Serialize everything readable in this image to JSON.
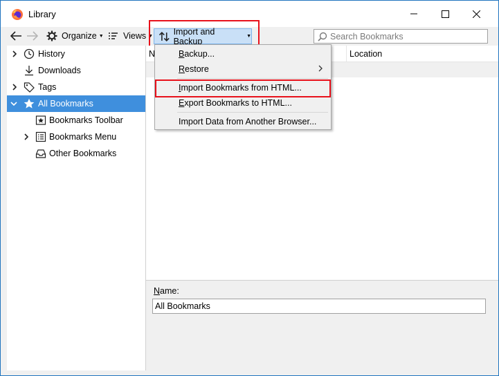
{
  "window": {
    "title": "Library",
    "controls": [
      "minimize",
      "maximize",
      "close"
    ]
  },
  "toolbar": {
    "back_icon": "arrow-left-icon",
    "forward_icon": "arrow-right-icon",
    "organize_label": "Organize",
    "views_label": "Views",
    "import_backup_label": "Import and Backup",
    "search_placeholder": "Search Bookmarks"
  },
  "sidebar": {
    "items": [
      {
        "label": "History",
        "icon": "clock-icon",
        "expandable": true,
        "selected": false
      },
      {
        "label": "Downloads",
        "icon": "download-icon",
        "expandable": false,
        "selected": false
      },
      {
        "label": "Tags",
        "icon": "tag-icon",
        "expandable": true,
        "selected": false
      },
      {
        "label": "All Bookmarks",
        "icon": "star-icon",
        "expandable": true,
        "expanded": true,
        "selected": true
      },
      {
        "label": "Bookmarks Toolbar",
        "icon": "bookmarks-toolbar-icon",
        "expandable": false,
        "selected": false
      },
      {
        "label": "Bookmarks Menu",
        "icon": "bookmarks-menu-icon",
        "expandable": true,
        "selected": false
      },
      {
        "label": "Other Bookmarks",
        "icon": "tray-icon",
        "expandable": false,
        "selected": false
      }
    ]
  },
  "columns": {
    "name_partial": "N",
    "location": "Location"
  },
  "menu": {
    "items": [
      {
        "label": "Backup...",
        "accel": "B",
        "rest": "ackup...",
        "submenu": false
      },
      {
        "label": "Restore",
        "accel": "R",
        "rest": "estore",
        "submenu": true
      },
      {
        "label": "Import Bookmarks from HTML...",
        "accel": "I",
        "rest": "mport Bookmarks from HTML...",
        "submenu": false,
        "highlighted_box": true
      },
      {
        "label": "Export Bookmarks to HTML...",
        "accel": "E",
        "rest": "xport Bookmarks to HTML...",
        "submenu": false
      },
      {
        "label": "Import Data from Another Browser...",
        "accel": "",
        "rest": "Import Data from Another Browser...",
        "submenu": false
      }
    ]
  },
  "details": {
    "name_label": "Name:",
    "name_accel": "N",
    "name_rest": "ame:",
    "name_value": "All Bookmarks"
  },
  "colors": {
    "selection": "#3f8fdd",
    "button_highlight": "#c9e0f7",
    "annotation_red": "#e8101a",
    "window_border": "#1e73be"
  }
}
